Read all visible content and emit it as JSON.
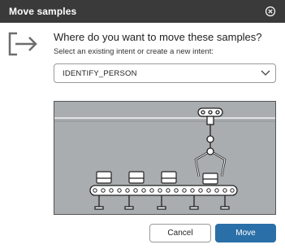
{
  "dialog": {
    "title": "Move samples",
    "close_icon": "close-circle-icon",
    "move_icon": "arrow-into-box-icon"
  },
  "content": {
    "heading": "Where do you want to move these samples?",
    "subheading": "Select an existing intent or create a new intent:"
  },
  "intent_select": {
    "value": "IDENTIFY_PERSON",
    "chevron_icon": "chevron-down-icon"
  },
  "illustration": {
    "subject": "conveyor-belt-robot-arm-icon"
  },
  "buttons": {
    "cancel_label": "Cancel",
    "move_label": "Move"
  },
  "colors": {
    "titlebar": "#3a3a3a",
    "primary": "#2b6fa8",
    "illustration_bg": "#a9adb0"
  }
}
